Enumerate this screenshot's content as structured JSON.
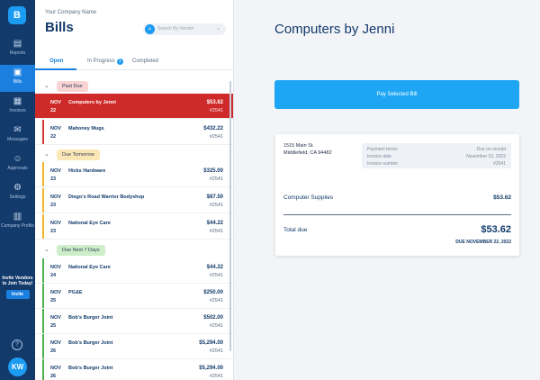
{
  "nav": {
    "logo": "B",
    "items": [
      {
        "label": "Reports",
        "icon": "chart-icon"
      },
      {
        "label": "Bills",
        "icon": "bills-icon"
      },
      {
        "label": "Invoices",
        "icon": "invoices-icon"
      },
      {
        "label": "Messages",
        "icon": "messages-icon"
      },
      {
        "label": "Approvals",
        "icon": "approvals-icon"
      },
      {
        "label": "Settings",
        "icon": "gear-icon"
      },
      {
        "label": "Company Profile",
        "icon": "building-icon"
      }
    ],
    "invite_text": "Invite Vendors to Join Today!",
    "invite_button": "Invite",
    "help": "?",
    "avatar": "KW"
  },
  "list": {
    "company": "Your Company Name",
    "title": "Bills",
    "search_placeholder": "Search By Vendor",
    "tabs": [
      {
        "label": "Open"
      },
      {
        "label": "In Progress",
        "badge": "1"
      },
      {
        "label": "Completed"
      }
    ],
    "sections": [
      {
        "label": "Past Due",
        "color": "#f9d4d4",
        "bar": "#d9383a"
      },
      {
        "label": "Due Tomorrow",
        "color": "#fbe7b5",
        "bar": "#f0b429"
      },
      {
        "label": "Due Next 7 Days",
        "color": "#cdeec9",
        "bar": "#4caf50"
      }
    ],
    "rows": [
      {
        "month": "NOV",
        "day": "22",
        "vendor": "Computers by Jenni",
        "amount": "$53.62",
        "invoice": "#2541"
      },
      {
        "month": "NOV",
        "day": "22",
        "vendor": "Mahoney Mugs",
        "amount": "$432.22",
        "invoice": "#2541"
      },
      {
        "month": "NOV",
        "day": "23",
        "vendor": "Hicks Hardware",
        "amount": "$325.00",
        "invoice": "#2541"
      },
      {
        "month": "NOV",
        "day": "23",
        "vendor": "Diego's Road Warrior Bodyshop",
        "amount": "$87.50",
        "invoice": "#2541"
      },
      {
        "month": "NOV",
        "day": "23",
        "vendor": "National Eye Care",
        "amount": "$44.22",
        "invoice": "#2541"
      },
      {
        "month": "NOV",
        "day": "24",
        "vendor": "National Eye Care",
        "amount": "$44.22",
        "invoice": "#2541"
      },
      {
        "month": "NOV",
        "day": "25",
        "vendor": "PG&E",
        "amount": "$250.00",
        "invoice": "#2541"
      },
      {
        "month": "NOV",
        "day": "25",
        "vendor": "Bob's Burger Joint",
        "amount": "$502.00",
        "invoice": "#2541"
      },
      {
        "month": "NOV",
        "day": "26",
        "vendor": "Bob's Burger Joint",
        "amount": "$5,294.00",
        "invoice": "#2541"
      },
      {
        "month": "NOV",
        "day": "26",
        "vendor": "Bob's Burger Joint",
        "amount": "$5,294.00",
        "invoice": "#2541"
      }
    ]
  },
  "detail": {
    "title": "Computers by Jenni",
    "pay_button": "Pay Selected Bill",
    "address_line1": "1515 Main St.",
    "address_line2": "Middlefield, CA 94482",
    "meta": [
      {
        "label": "Payment terms",
        "value": "Due on receipt"
      },
      {
        "label": "Invoice date",
        "value": "November 22, 2022"
      },
      {
        "label": "Invoice number",
        "value": "#2541"
      }
    ],
    "line_item": "Computer Supplies",
    "line_amount": "$53.62",
    "total_label": "Total due",
    "total_amount": "$53.62",
    "due_text": "DUE NOVEMBER 22, 2022"
  },
  "colors": {
    "accent": "#1b7fe0",
    "selected": "#cf2a2a",
    "rail": "#123a6b"
  }
}
